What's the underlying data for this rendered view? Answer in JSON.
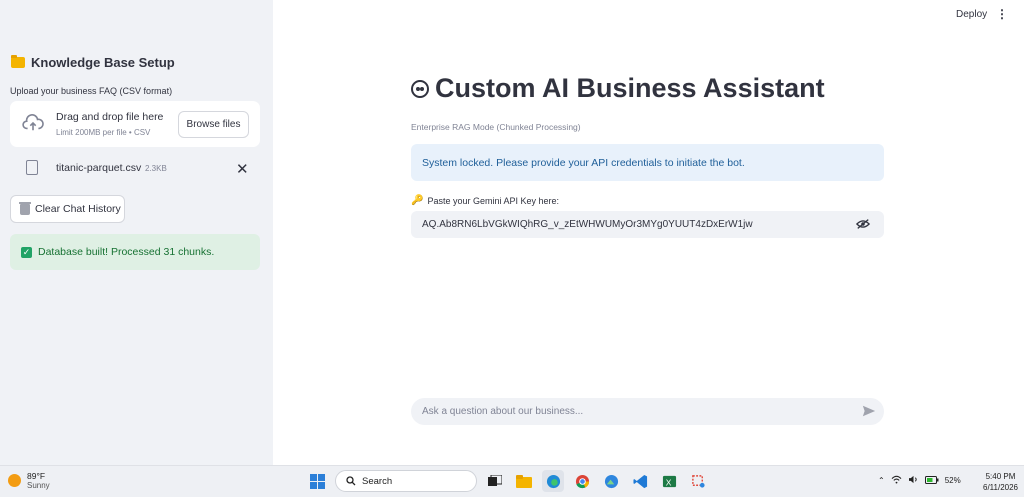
{
  "sidebar": {
    "title": "Knowledge Base Setup",
    "upload_label": "Upload your business FAQ (CSV format)",
    "dropzone": {
      "main_text": "Drag and drop file here",
      "sub_text": "Limit 200MB per file • CSV",
      "browse_label": "Browse files"
    },
    "file": {
      "name": "titanic-parquet.csv",
      "size": "2.3KB",
      "remove_glyph": "✕"
    },
    "clear_button": "Clear Chat History",
    "status": "Database built! Processed 31 chunks."
  },
  "header": {
    "deploy_label": "Deploy",
    "menu_glyph": "⋮"
  },
  "main": {
    "title": "Custom AI Business Assistant",
    "caption": "Enterprise RAG Mode (Chunked Processing)",
    "info": "System locked. Please provide your API credentials to initiate the bot.",
    "api_key_label": "Paste your Gemini API Key here:",
    "api_key_value": "AQ.Ab8RN6LbVGkWIQhRG_v_zEtWHWUMyOr3MYg0YUUT4zDxErW1jw",
    "chat_placeholder": "Ask a question about our business..."
  },
  "taskbar": {
    "weather_temp": "89°F",
    "weather_condition": "Sunny",
    "search_label": "Search",
    "battery": "52%",
    "time": "5:40 PM",
    "date": "6/11/2026"
  },
  "colors": {
    "sidebar_bg": "#f0f2f6",
    "info_bg": "#e8f1fb",
    "success_bg": "#dff0e4",
    "success_text": "#177233"
  }
}
